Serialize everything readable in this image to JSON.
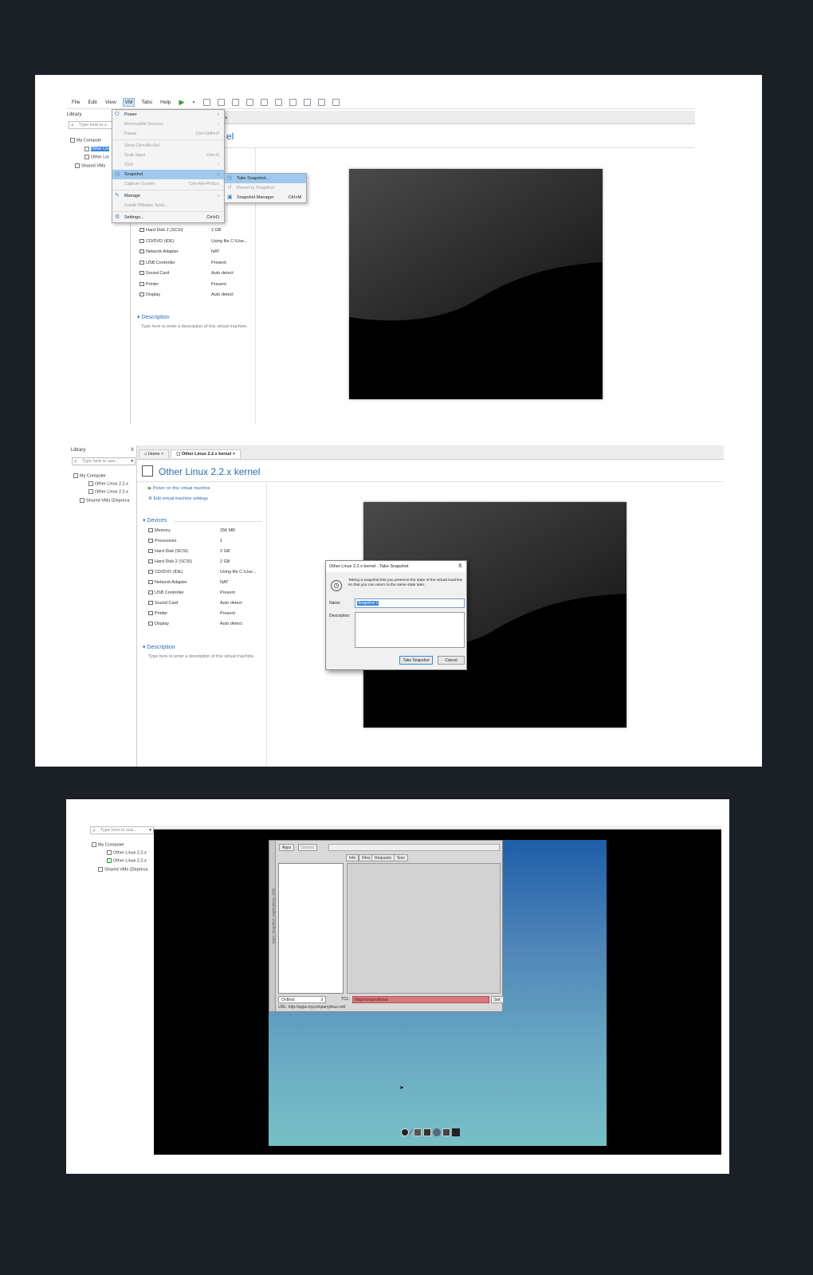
{
  "colors": {
    "page_bg": "#1b1f26",
    "accent": "#2a6fb4",
    "highlight": "#9fc9ef"
  },
  "shot1": {
    "menubar": {
      "items": [
        "File",
        "Edit",
        "View",
        "VM",
        "Tabs",
        "Help"
      ]
    },
    "sidebar": {
      "title": "Library",
      "search_placeholder": "Type here to s",
      "tree": [
        "My Compute",
        "Other Lin",
        "Other Lin",
        "Shared VMs"
      ]
    },
    "tab_partial": "el",
    "vm_menu": [
      {
        "label": "Power",
        "shortcut": "",
        "icon": "power-icon",
        "disabled": false
      },
      {
        "label": "Removable Devices",
        "shortcut": "",
        "icon": "",
        "disabled": true
      },
      {
        "label": "Pause",
        "shortcut": "Ctrl+Shift+P",
        "icon": "",
        "disabled": true
      },
      {
        "label": "Send Ctrl+Alt+Del",
        "shortcut": "",
        "icon": "",
        "disabled": true
      },
      {
        "label": "Grab Input",
        "shortcut": "Ctrl+G",
        "icon": "",
        "disabled": true
      },
      {
        "label": "SSH",
        "shortcut": "",
        "icon": "",
        "disabled": true
      },
      {
        "label": "Snapshot",
        "shortcut": "",
        "icon": "snapshot-icon",
        "disabled": false,
        "highlighted": true
      },
      {
        "label": "Capture Screen",
        "shortcut": "Ctrl+Alt+PrtScn",
        "icon": "",
        "disabled": true
      },
      {
        "label": "Manage",
        "shortcut": "",
        "icon": "wrench-icon",
        "disabled": false
      },
      {
        "label": "Install VMware Tools...",
        "shortcut": "",
        "icon": "",
        "disabled": true
      },
      {
        "label": "Settings...",
        "shortcut": "Ctrl+D",
        "icon": "settings-icon",
        "disabled": false
      }
    ],
    "snapshot_submenu": [
      {
        "label": "Take Snapshot...",
        "shortcut": "",
        "highlighted": true
      },
      {
        "label": "Revert to Snapshot",
        "shortcut": "",
        "disabled": true
      },
      {
        "label": "Snapshot Manager",
        "shortcut": "Ctrl+M"
      }
    ],
    "devices": [
      {
        "name": "Hard Disk 2 (SCSI)",
        "value": "2 GB"
      },
      {
        "name": "CD/DVD (IDE)",
        "value": "Using file C:\\Use..."
      },
      {
        "name": "Network Adapter",
        "value": "NAT"
      },
      {
        "name": "USB Controller",
        "value": "Present"
      },
      {
        "name": "Sound Card",
        "value": "Auto detect"
      },
      {
        "name": "Printer",
        "value": "Present"
      },
      {
        "name": "Display",
        "value": "Auto detect"
      }
    ],
    "description_header": "Description",
    "description_text": "Type here to enter a description of this virtual machine."
  },
  "shot2": {
    "sidebar": {
      "title": "Library",
      "close": "X",
      "search_placeholder": "Type here to sea...",
      "tree": [
        "My Computer",
        "Other Linux 2.2.x",
        "Other Linux 2.2.x",
        "Shared VMs (Depreca"
      ]
    },
    "tabs": [
      {
        "label": "Home"
      },
      {
        "label": "Other Linux 2.2.x kernel"
      }
    ],
    "vm_title": "Other Linux 2.2.x kernel",
    "actions": [
      "Power on this virtual machine",
      "Edit virtual machine settings"
    ],
    "devices_header": "Devices",
    "devices": [
      {
        "name": "Memory",
        "value": "256 MB"
      },
      {
        "name": "Processors",
        "value": "1"
      },
      {
        "name": "Hard Disk (SCSI)",
        "value": "2 GB"
      },
      {
        "name": "Hard Disk 2 (SCSI)",
        "value": "2 GB"
      },
      {
        "name": "CD/DVD (IDE)",
        "value": "Using file C:\\Use..."
      },
      {
        "name": "Network Adapter",
        "value": "NAT"
      },
      {
        "name": "USB Controller",
        "value": "Present"
      },
      {
        "name": "Sound Card",
        "value": "Auto detect"
      },
      {
        "name": "Printer",
        "value": "Present"
      },
      {
        "name": "Display",
        "value": "Auto detect"
      }
    ],
    "description_header": "Description",
    "description_text": "Type here to enter a description of this virtual machine.",
    "dialog": {
      "title": "Other Linux 2.2.x kernel - Take Snapshot",
      "close": "X",
      "info": "Taking a snapshot lets you preserve the state of the virtual machine so that you can return to the same state later.",
      "name_label": "Name:",
      "name_value": "Snapshot 1",
      "description_label": "Description:",
      "take_button": "Take Snapshot",
      "cancel_button": "Cancel"
    }
  },
  "shot3": {
    "sidebar": {
      "search_placeholder": "Type here to sea...",
      "tree": [
        "My Computer",
        "Other Linux 2.2.x",
        "Other Linux 2.2.x",
        "Shared VMs (Depreca"
      ]
    },
    "app": {
      "buttons": [
        "Apps",
        "Search"
      ],
      "side_label": "Apps: Snapshot: Applications: (0/0)",
      "col_tabs": [
        "Info",
        "Files",
        "Requests",
        "Size"
      ],
      "filter_value": "OnBest",
      "tcl_label": "TCL:",
      "tcl_value": "/http/compositional",
      "set_button": "Set",
      "url": "URL: http://apps.mycompanylinux.net/"
    }
  }
}
